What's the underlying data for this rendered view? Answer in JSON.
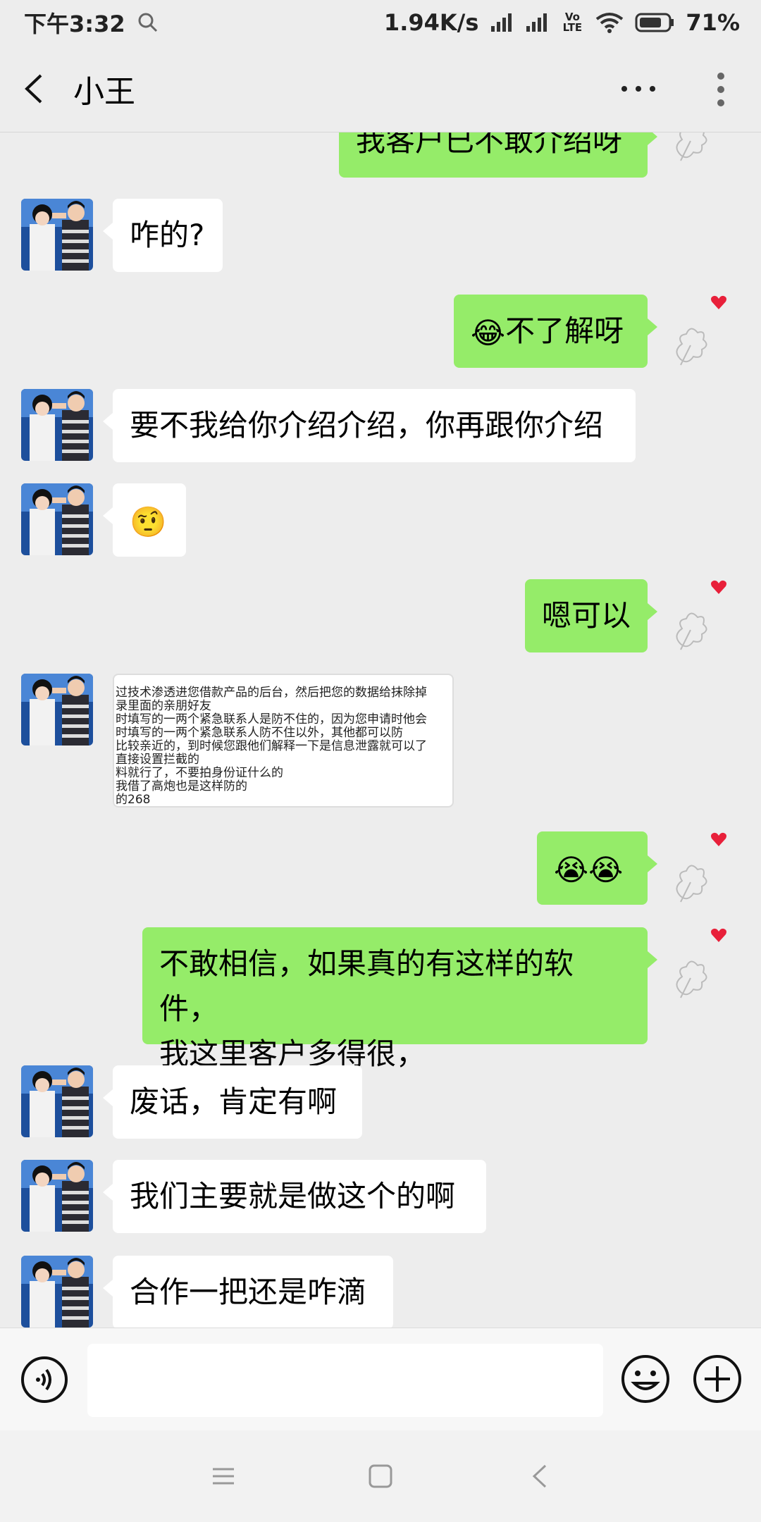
{
  "status_bar": {
    "time": "下午3:32",
    "net_speed": "1.94K/s",
    "volte": "Vo LTE",
    "battery": "71%"
  },
  "header": {
    "contact_name": "小王"
  },
  "messages": [
    {
      "side": "out",
      "text": "我客户已不敢介绍呀"
    },
    {
      "side": "in",
      "text": "咋的?"
    },
    {
      "side": "out",
      "text": "不了解呀",
      "emoji": "😂"
    },
    {
      "side": "in",
      "text": "要不我给你介绍介绍，你再跟你介绍"
    },
    {
      "side": "in",
      "emoji": "🤨"
    },
    {
      "side": "out",
      "text": "嗯可以"
    },
    {
      "side": "in",
      "type": "image",
      "image_lines": [
        "过技术渗透进您借款产品的后台，然后把您的数据给抹除掉",
        "录里面的亲朋好友",
        "时填写的一两个紧急联系人是防不住的，因为您申请时他会",
        "时填写的一两个紧急联系人防不住以外，其他都可以防",
        "比较亲近的，到时候您跟他们解释一下是信息泄露就可以了",
        "直接设置拦截的",
        "料就行了，不要拍身份证什么的",
        "我借了高炮也是这样防的",
        "的268"
      ]
    },
    {
      "side": "out",
      "emoji": "😭😭"
    },
    {
      "side": "out",
      "text": "不敢相信，如果真的有这样的软件，我这里客户多得很，",
      "text_lines": [
        "不敢相信，如果真的有这样的软件，",
        "我这里客户多得很，"
      ]
    },
    {
      "side": "in",
      "text": "废话，肯定有啊"
    },
    {
      "side": "in",
      "text": "我们主要就是做这个的啊"
    },
    {
      "side": "in",
      "text": "合作一把还是咋滴"
    }
  ],
  "input": {
    "placeholder": ""
  },
  "colors": {
    "out_bubble": "#95ec69",
    "in_bubble": "#ffffff",
    "background": "#ededed",
    "heart": "#e8203a"
  }
}
